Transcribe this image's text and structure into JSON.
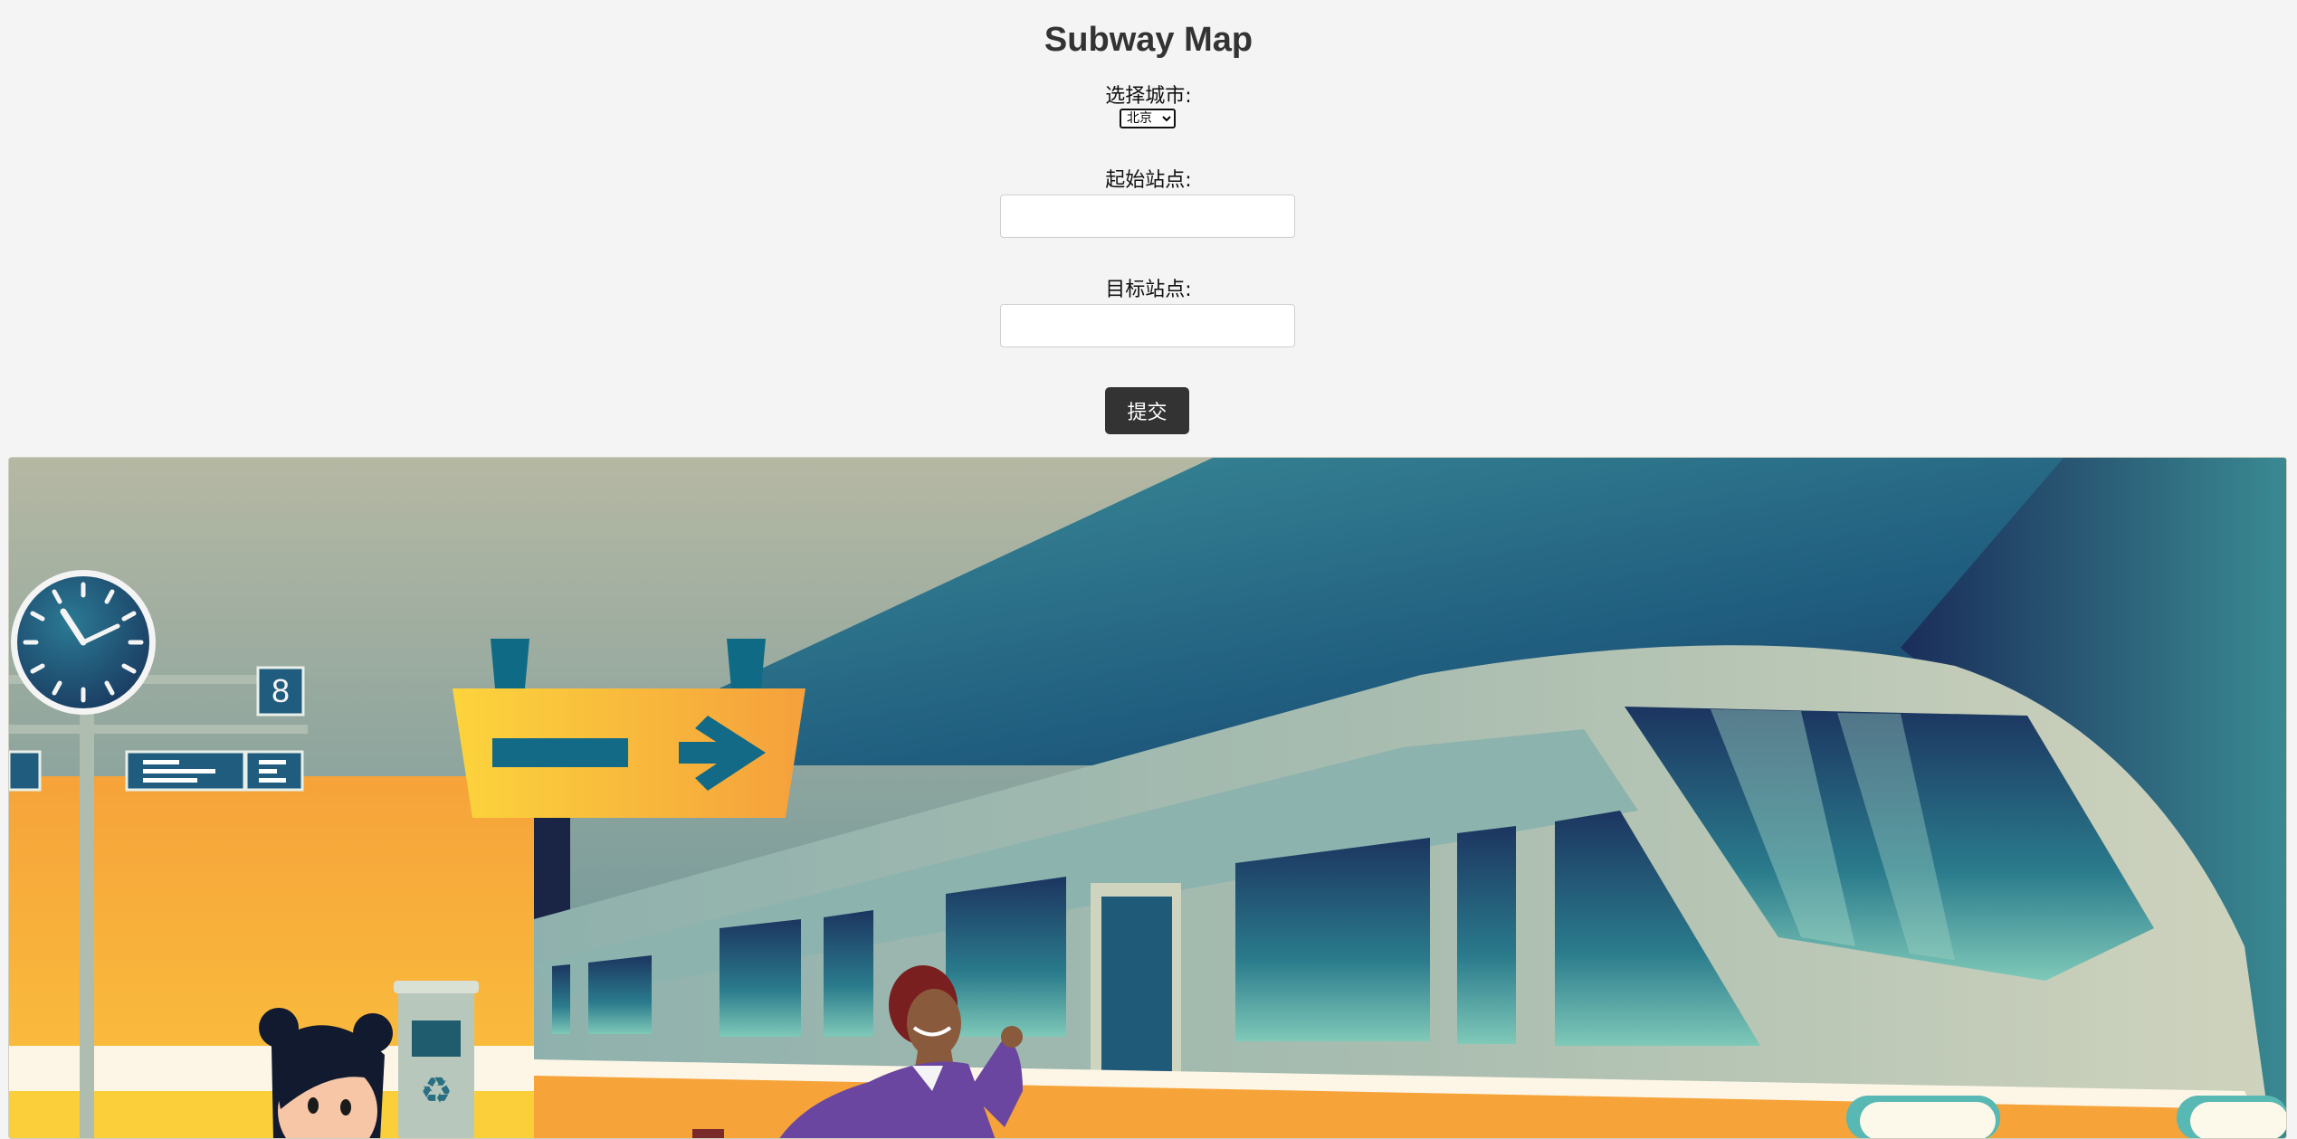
{
  "page": {
    "title": "Subway Map"
  },
  "form": {
    "city_label": "选择城市:",
    "city_selected": "北京",
    "start_label": "起始站点:",
    "start_value": "",
    "end_label": "目标站点:",
    "end_value": "",
    "submit_label": "提交"
  },
  "banner": {
    "platform_number": "8",
    "icons": [
      "clock-icon",
      "direction-arrow-icon",
      "recycle-icon"
    ],
    "colors": {
      "teal": "#1d6b86",
      "yellow": "#fbcf3a",
      "orange": "#f5a030",
      "navy": "#1a2545",
      "silver": "#aebdb0"
    }
  }
}
